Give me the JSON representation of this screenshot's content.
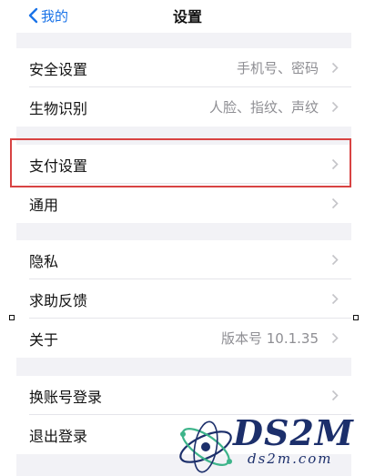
{
  "nav": {
    "back_label": "我的",
    "title": "设置"
  },
  "groups": [
    {
      "rows": [
        {
          "label": "安全设置",
          "value": "手机号、密码"
        },
        {
          "label": "生物识别",
          "value": "人脸、指纹、声纹"
        }
      ]
    },
    {
      "rows": [
        {
          "label": "支付设置",
          "value": ""
        },
        {
          "label": "通用",
          "value": ""
        }
      ]
    },
    {
      "rows": [
        {
          "label": "隐私",
          "value": ""
        },
        {
          "label": "求助反馈",
          "value": ""
        },
        {
          "label": "关于",
          "value": "版本号 10.1.35"
        }
      ]
    },
    {
      "rows": [
        {
          "label": "换账号登录",
          "value": ""
        },
        {
          "label": "退出登录",
          "value": ""
        }
      ]
    }
  ],
  "watermark": {
    "logo_text": "DS2M",
    "domain_text": "ds2m.com"
  },
  "colors": {
    "accent": "#1a73e8",
    "highlight_border": "#d84343",
    "background_gray": "#f2f2f6"
  }
}
